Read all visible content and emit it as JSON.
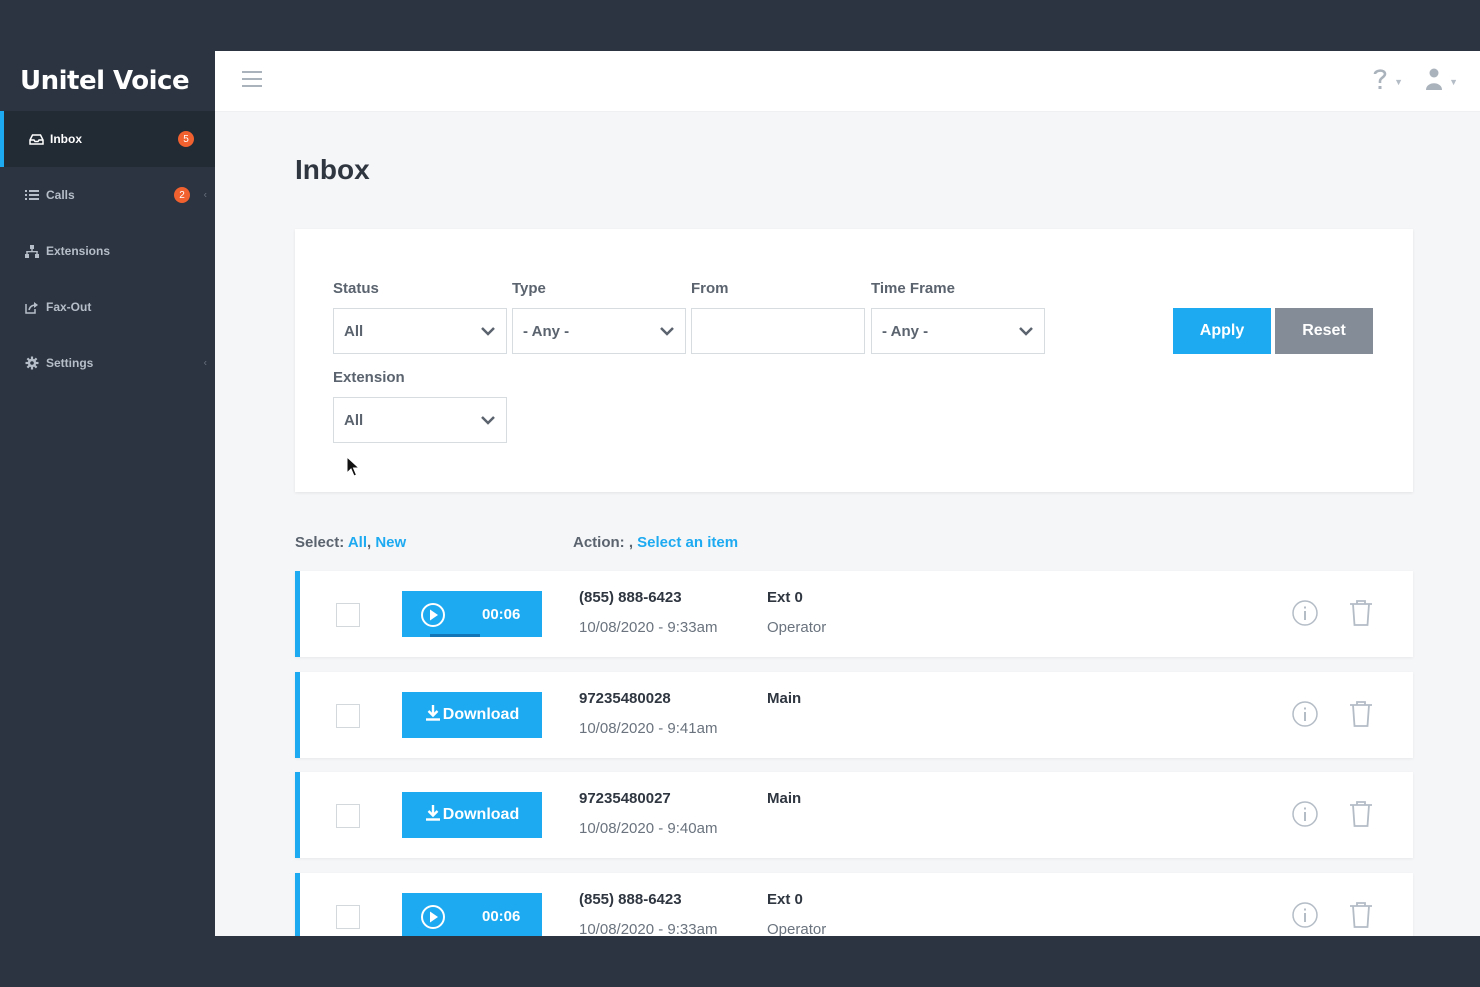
{
  "brand": "Unitel Voice",
  "sidebar": {
    "items": [
      {
        "label": "Inbox",
        "badge": "5",
        "icon": "inbox-icon",
        "active": true
      },
      {
        "label": "Calls",
        "badge": "2",
        "icon": "list-icon"
      },
      {
        "label": "Extensions",
        "icon": "sitemap-icon"
      },
      {
        "label": "Fax-Out",
        "icon": "share-icon"
      },
      {
        "label": "Settings",
        "icon": "gear-icon"
      }
    ]
  },
  "page": {
    "title": "Inbox"
  },
  "filters": {
    "status": {
      "label": "Status",
      "value": "All"
    },
    "type": {
      "label": "Type",
      "value": "- Any -"
    },
    "from": {
      "label": "From",
      "value": ""
    },
    "timeframe": {
      "label": "Time Frame",
      "value": "- Any -"
    },
    "extension": {
      "label": "Extension",
      "value": "All"
    },
    "apply_label": "Apply",
    "reset_label": "Reset"
  },
  "select_bar": {
    "label": "Select:",
    "all": "All",
    "separator": ",",
    "new": "New"
  },
  "action_bar": {
    "label": "Action: ,",
    "placeholder": "Select an item"
  },
  "messages": [
    {
      "kind": "audio",
      "duration": "00:06",
      "number": "(855) 888-6423",
      "datetime": "10/08/2020 - 9:33am",
      "ext": "Ext 0",
      "sub": "Operator"
    },
    {
      "kind": "fax",
      "download_label": "Download",
      "number": "97235480028",
      "datetime": "10/08/2020 - 9:41am",
      "ext": "Main",
      "sub": ""
    },
    {
      "kind": "fax",
      "download_label": "Download",
      "number": "97235480027",
      "datetime": "10/08/2020 - 9:40am",
      "ext": "Main",
      "sub": ""
    },
    {
      "kind": "audio",
      "duration": "00:06",
      "number": "(855) 888-6423",
      "datetime": "10/08/2020 - 9:33am",
      "ext": "Ext 0",
      "sub": "Operator"
    }
  ],
  "colors": {
    "accent": "#1eaaf1",
    "sidebar": "#2b3440",
    "badge": "#f0612f",
    "reset": "#838c97"
  }
}
